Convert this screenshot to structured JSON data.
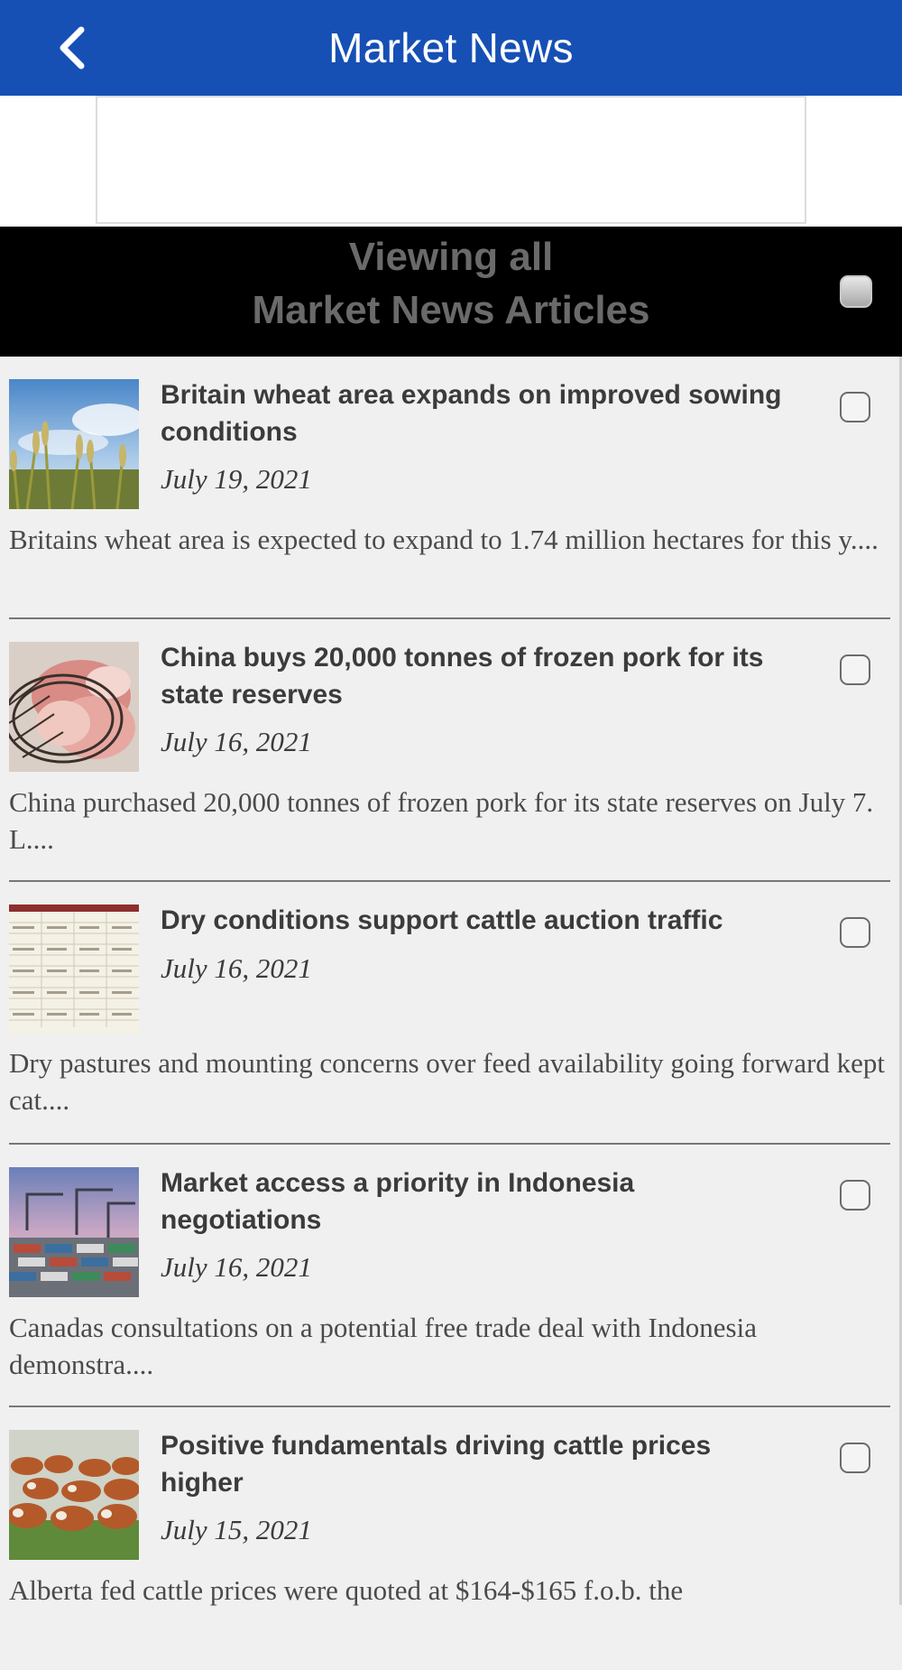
{
  "header": {
    "title": "Market News",
    "back_icon": "chevron-left-icon"
  },
  "banner": {
    "line1": "Viewing all",
    "line2": "Market News Articles"
  },
  "articles": [
    {
      "title": "Britain wheat area expands on improved sowing conditions",
      "date": "July 19, 2021",
      "summary": "Britains wheat area is expected to expand to 1.74 million hectares for this y....",
      "thumb": "wheat-field"
    },
    {
      "title": "China buys 20,000 tonnes of frozen pork for its state reserves",
      "date": "July 16, 2021",
      "summary": "China purchased 20,000 tonnes of frozen pork for its state reserves on July 7. L....",
      "thumb": "raw-pork"
    },
    {
      "title": "Dry conditions support cattle auction traffic",
      "date": "July 16, 2021",
      "summary": "Dry pastures and mounting concerns over feed availability going forward kept cat....",
      "thumb": "price-table"
    },
    {
      "title": "Market access a priority in Indonesia negotiations",
      "date": "July 16, 2021",
      "summary": "Canadas consultations on a potential free trade deal with Indonesia demonstra....",
      "thumb": "shipping-port"
    },
    {
      "title": "Positive fundamentals driving cattle prices higher",
      "date": "July 15, 2021",
      "summary": "Alberta fed cattle prices were quoted at $164-$165 f.o.b. the",
      "thumb": "cattle-herd"
    }
  ],
  "colors": {
    "header_bg": "#1650b5",
    "banner_bg": "#000000",
    "banner_text": "#6a6a6a",
    "page_bg": "#f0f0f0"
  }
}
